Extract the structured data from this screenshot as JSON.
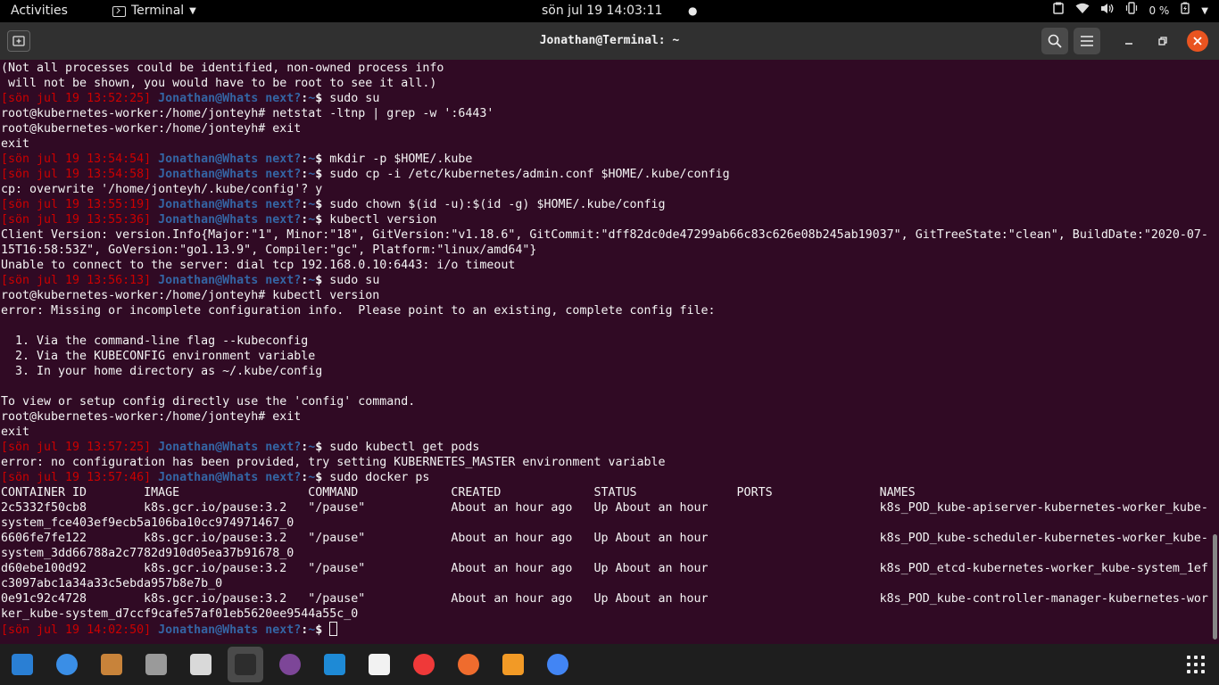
{
  "topbar": {
    "activities": "Activities",
    "app_name": "Terminal",
    "clock": "sön jul 19 14:03:11",
    "notification_dot": "●",
    "battery": "0 %"
  },
  "window": {
    "title": "Jonathan@Terminal: ~"
  },
  "prompt": {
    "user": "Jonathan@Whats next?",
    "sep": ":",
    "path": "~",
    "symbol": "$ "
  },
  "terminal_lines": [
    {
      "text": "(Not all processes could be identified, non-owned process info"
    },
    {
      "text": " will not be shown, you would have to be root to see it all.)"
    },
    {
      "prompt": true,
      "time": "[sön jul 19 13:52:25] ",
      "cmd": "sudo su"
    },
    {
      "text": "root@kubernetes-worker:/home/jonteyh# netstat -ltnp | grep -w ':6443'"
    },
    {
      "text": "root@kubernetes-worker:/home/jonteyh# exit"
    },
    {
      "text": "exit"
    },
    {
      "prompt": true,
      "time": "[sön jul 19 13:54:54] ",
      "cmd": "mkdir -p $HOME/.kube"
    },
    {
      "prompt": true,
      "time": "[sön jul 19 13:54:58] ",
      "cmd": "sudo cp -i /etc/kubernetes/admin.conf $HOME/.kube/config"
    },
    {
      "text": "cp: overwrite '/home/jonteyh/.kube/config'? y"
    },
    {
      "prompt": true,
      "time": "[sön jul 19 13:55:19] ",
      "cmd": "sudo chown $(id -u):$(id -g) $HOME/.kube/config"
    },
    {
      "prompt": true,
      "time": "[sön jul 19 13:55:36] ",
      "cmd": "kubectl version"
    },
    {
      "text": "Client Version: version.Info{Major:\"1\", Minor:\"18\", GitVersion:\"v1.18.6\", GitCommit:\"dff82dc0de47299ab66c83c626e08b245ab19037\", GitTreeState:\"clean\", BuildDate:\"2020-07-"
    },
    {
      "text": "15T16:58:53Z\", GoVersion:\"go1.13.9\", Compiler:\"gc\", Platform:\"linux/amd64\"}"
    },
    {
      "text": "Unable to connect to the server: dial tcp 192.168.0.10:6443: i/o timeout"
    },
    {
      "prompt": true,
      "time": "[sön jul 19 13:56:13] ",
      "cmd": "sudo su"
    },
    {
      "text": "root@kubernetes-worker:/home/jonteyh# kubectl version"
    },
    {
      "text": "error: Missing or incomplete configuration info.  Please point to an existing, complete config file:"
    },
    {
      "text": ""
    },
    {
      "text": "  1. Via the command-line flag --kubeconfig"
    },
    {
      "text": "  2. Via the KUBECONFIG environment variable"
    },
    {
      "text": "  3. In your home directory as ~/.kube/config"
    },
    {
      "text": ""
    },
    {
      "text": "To view or setup config directly use the 'config' command."
    },
    {
      "text": "root@kubernetes-worker:/home/jonteyh# exit"
    },
    {
      "text": "exit"
    },
    {
      "prompt": true,
      "time": "[sön jul 19 13:57:25] ",
      "cmd": "sudo kubectl get pods"
    },
    {
      "text": "error: no configuration has been provided, try setting KUBERNETES_MASTER environment variable"
    },
    {
      "prompt": true,
      "time": "[sön jul 19 13:57:46] ",
      "cmd": "sudo docker ps"
    },
    {
      "text": "CONTAINER ID        IMAGE                  COMMAND             CREATED             STATUS              PORTS               NAMES"
    },
    {
      "text": "2c5332f50cb8        k8s.gcr.io/pause:3.2   \"/pause\"            About an hour ago   Up About an hour                        k8s_POD_kube-apiserver-kubernetes-worker_kube-"
    },
    {
      "text": "system_fce403ef9ecb5a106ba10cc974971467_0"
    },
    {
      "text": "6606fe7fe122        k8s.gcr.io/pause:3.2   \"/pause\"            About an hour ago   Up About an hour                        k8s_POD_kube-scheduler-kubernetes-worker_kube-"
    },
    {
      "text": "system_3dd66788a2c7782d910d05ea37b91678_0"
    },
    {
      "text": "d60ebe100d92        k8s.gcr.io/pause:3.2   \"/pause\"            About an hour ago   Up About an hour                        k8s_POD_etcd-kubernetes-worker_kube-system_1ef"
    },
    {
      "text": "c3097abc1a34a33c5ebda957b8e7b_0"
    },
    {
      "text": "0e91c92c4728        k8s.gcr.io/pause:3.2   \"/pause\"            About an hour ago   Up About an hour                        k8s_POD_kube-controller-manager-kubernetes-wor"
    },
    {
      "text": "ker_kube-system_d7ccf9cafe57af01eb5620ee9544a55c_0"
    },
    {
      "prompt": true,
      "time": "[sön jul 19 14:02:50] ",
      "cmd": "",
      "cursor": true
    }
  ],
  "dock": {
    "items": [
      {
        "name": "libreoffice-writer-icon",
        "color": "#2a7fd4"
      },
      {
        "name": "help-icon",
        "color": "#3a8ee6"
      },
      {
        "name": "books-icon",
        "color": "#c8833a"
      },
      {
        "name": "files-icon",
        "color": "#9a9a9a"
      },
      {
        "name": "document-viewer-icon",
        "color": "#d9d9d9"
      },
      {
        "name": "terminal-icon",
        "color": "#2d2d2d",
        "active": true
      },
      {
        "name": "tor-browser-icon",
        "color": "#7d4698"
      },
      {
        "name": "vscode-icon",
        "color": "#1e8ad6"
      },
      {
        "name": "solitaire-icon",
        "color": "#f2f2f2"
      },
      {
        "name": "vivaldi-icon",
        "color": "#ef3939"
      },
      {
        "name": "postman-icon",
        "color": "#ef6c2e"
      },
      {
        "name": "sublime-text-icon",
        "color": "#f29a26"
      },
      {
        "name": "chrome-icon",
        "color": "#4285f4"
      }
    ]
  },
  "colors": {
    "terminal_bg": "#300a24",
    "prompt_time": "#cc0000",
    "prompt_user": "#3465a4",
    "close_button": "#e95420"
  }
}
